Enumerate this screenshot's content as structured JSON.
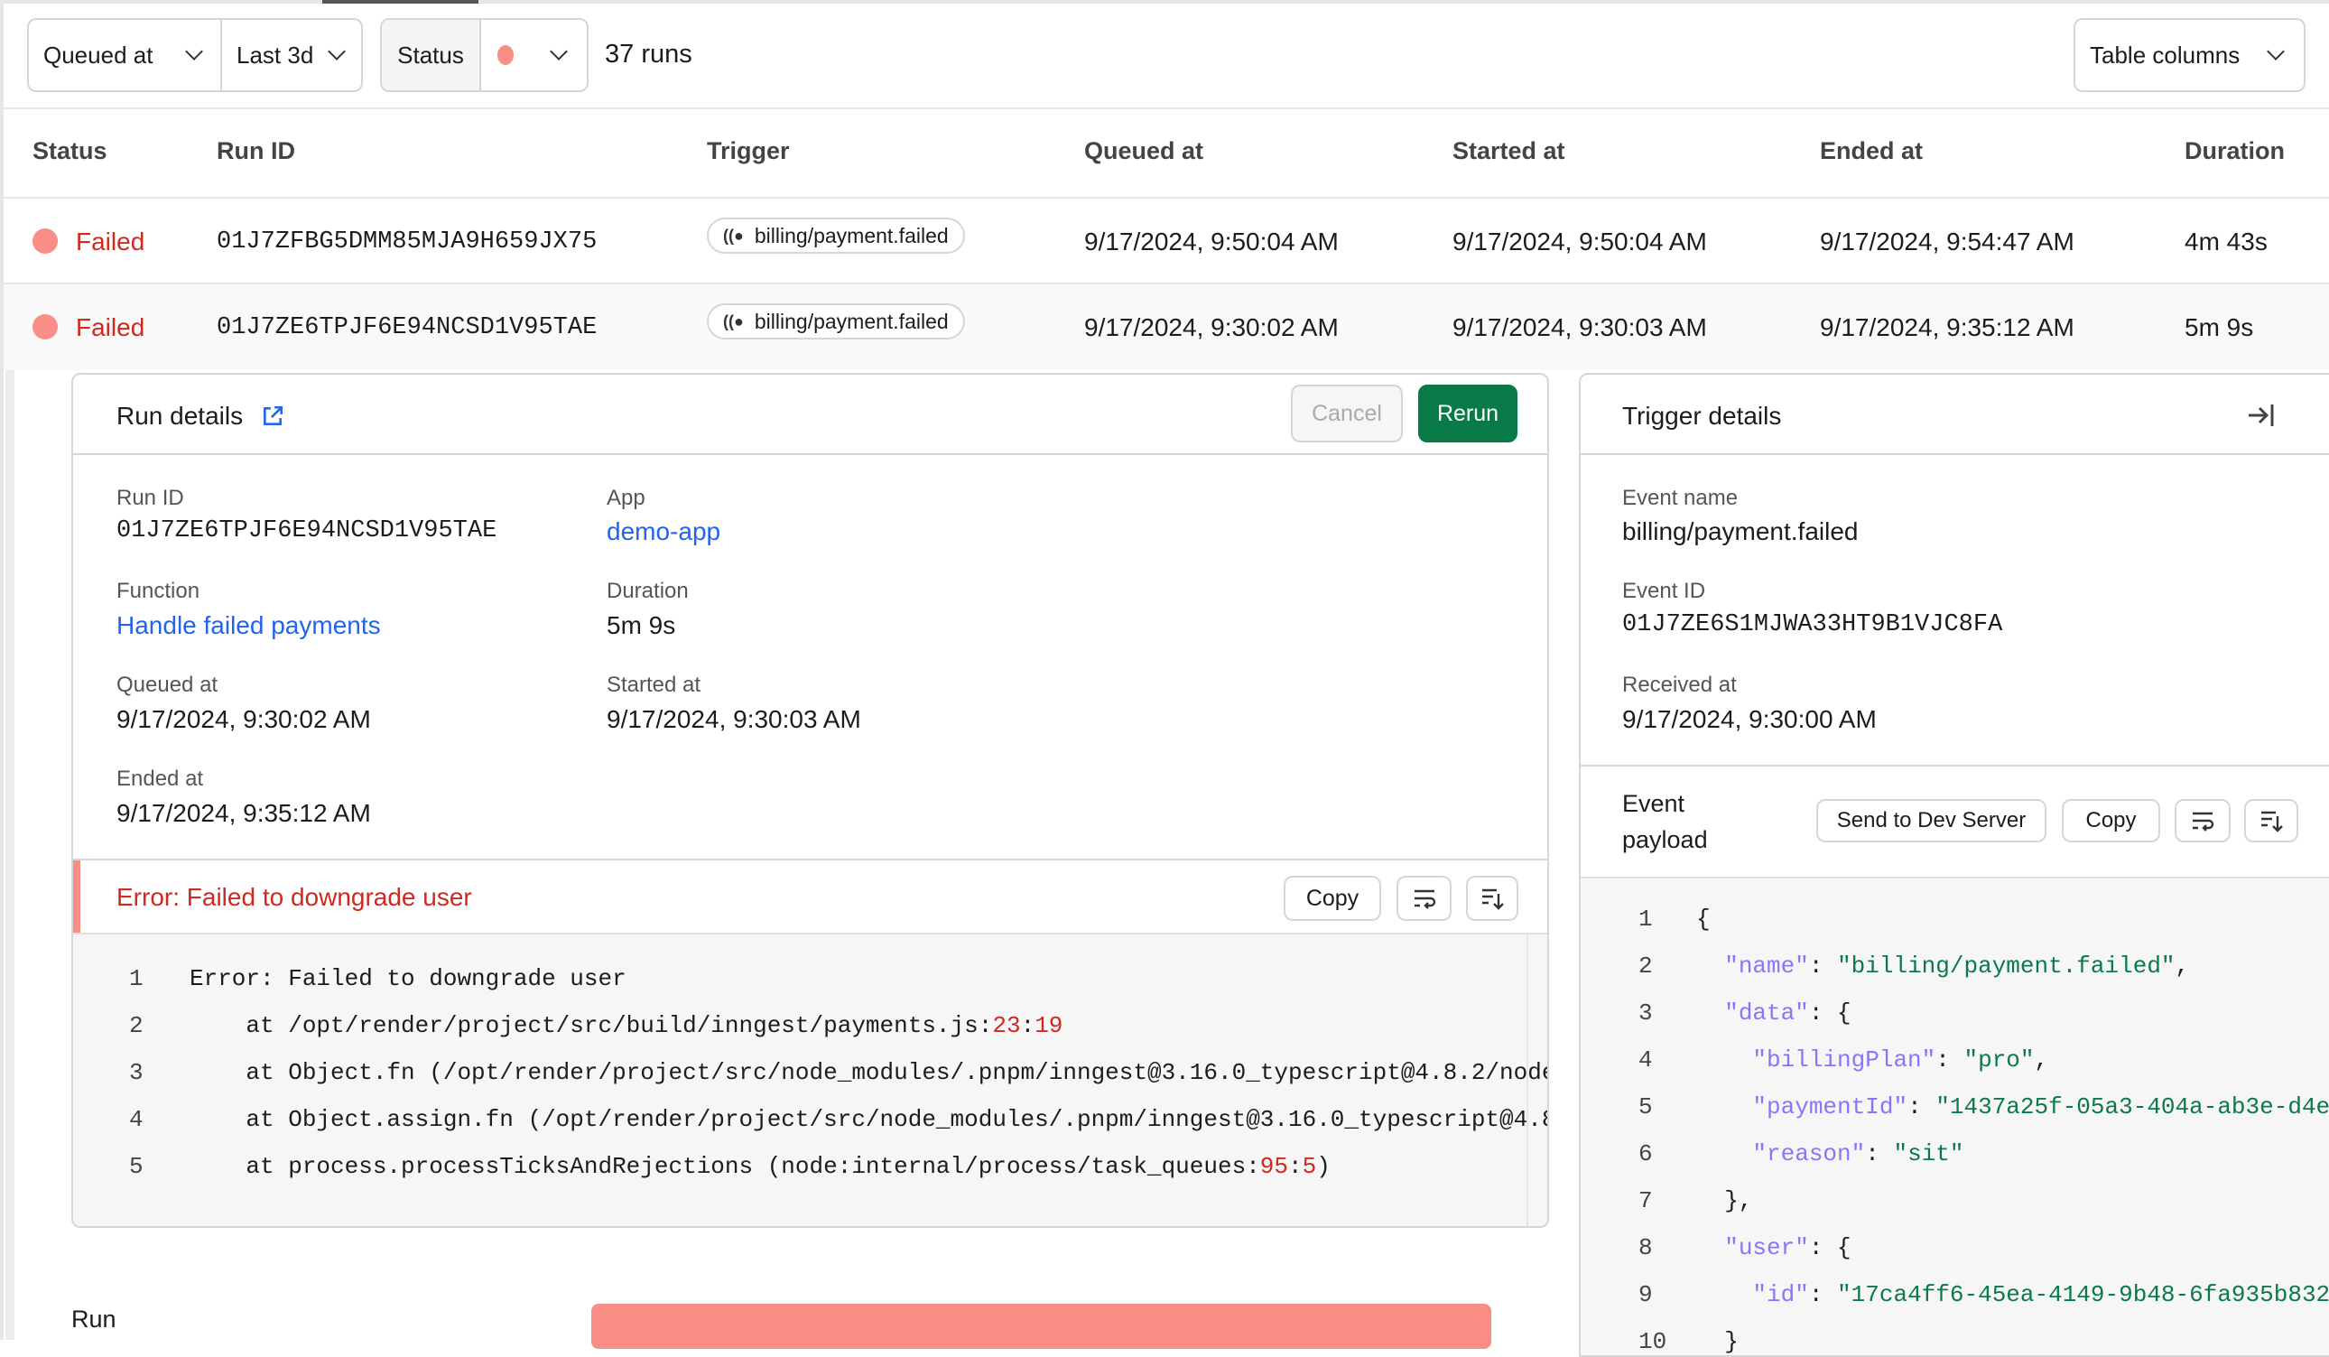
{
  "toolbar": {
    "time_field": "Queued at",
    "time_range": "Last 3d",
    "status_label": "Status",
    "status_color": "#f98e87",
    "run_count": "37 runs",
    "table_columns": "Table columns"
  },
  "table": {
    "headers": [
      "Status",
      "Run ID",
      "Trigger",
      "Queued at",
      "Started at",
      "Ended at",
      "Duration"
    ],
    "rows": [
      {
        "status": "Failed",
        "run_id": "01J7ZFBG5DMM85MJA9H659JX75",
        "trigger": "billing/payment.failed",
        "queued": "9/17/2024, 9:50:04 AM",
        "started": "9/17/2024, 9:50:04 AM",
        "ended": "9/17/2024, 9:54:47 AM",
        "duration": "4m 43s"
      },
      {
        "status": "Failed",
        "run_id": "01J7ZE6TPJF6E94NCSD1V95TAE",
        "trigger": "billing/payment.failed",
        "queued": "9/17/2024, 9:30:02 AM",
        "started": "9/17/2024, 9:30:03 AM",
        "ended": "9/17/2024, 9:35:12 AM",
        "duration": "5m 9s"
      }
    ]
  },
  "run_details": {
    "title": "Run details",
    "cancel": "Cancel",
    "rerun": "Rerun",
    "fields": {
      "run_id": {
        "label": "Run ID",
        "value": "01J7ZE6TPJF6E94NCSD1V95TAE"
      },
      "app": {
        "label": "App",
        "value": "demo-app"
      },
      "function": {
        "label": "Function",
        "value": "Handle failed payments"
      },
      "duration": {
        "label": "Duration",
        "value": "5m 9s"
      },
      "queued": {
        "label": "Queued at",
        "value": "9/17/2024, 9:30:02 AM"
      },
      "started": {
        "label": "Started at",
        "value": "9/17/2024, 9:30:03 AM"
      },
      "ended": {
        "label": "Ended at",
        "value": "9/17/2024, 9:35:12 AM"
      }
    },
    "error": {
      "title": "Error: Failed to downgrade user",
      "copy": "Copy",
      "lines": [
        [
          {
            "t": "Error: Failed to downgrade user"
          }
        ],
        [
          {
            "t": "    at /opt/render/project/src/build/inngest/payments.js:"
          },
          {
            "t": "23",
            "c": "num"
          },
          {
            "t": ":"
          },
          {
            "t": "19",
            "c": "num"
          }
        ],
        [
          {
            "t": "    at Object.fn (/opt/render/project/src/node_modules/.pnpm/inngest@3.16.0_typescript@4.8.2/node"
          }
        ],
        [
          {
            "t": "    at Object.assign.fn (/opt/render/project/src/node_modules/.pnpm/inngest@3.16.0_typescript@4.8"
          }
        ],
        [
          {
            "t": "    at process.processTicksAndRejections (node:internal/process/task_queues:"
          },
          {
            "t": "95",
            "c": "num"
          },
          {
            "t": ":"
          },
          {
            "t": "5",
            "c": "num"
          },
          {
            "t": ")"
          }
        ]
      ]
    },
    "timeline_label": "Run",
    "timeline_color": "#f98e87"
  },
  "trigger_details": {
    "title": "Trigger details",
    "fields": {
      "event_name": {
        "label": "Event name",
        "value": "billing/payment.failed"
      },
      "event_id": {
        "label": "Event ID",
        "value": "01J7ZE6S1MJWA33HT9B1VJC8FA"
      },
      "received": {
        "label": "Received at",
        "value": "9/17/2024, 9:30:00 AM"
      }
    },
    "payload_label": "Event payload",
    "send_dev": "Send to Dev Server",
    "copy": "Copy",
    "payload_lines": [
      [
        {
          "t": "{"
        }
      ],
      [
        {
          "t": "  "
        },
        {
          "t": "\"name\"",
          "c": "key"
        },
        {
          "t": ": "
        },
        {
          "t": "\"billing/payment.failed\"",
          "c": "str"
        },
        {
          "t": ","
        }
      ],
      [
        {
          "t": "  "
        },
        {
          "t": "\"data\"",
          "c": "key"
        },
        {
          "t": ": {"
        }
      ],
      [
        {
          "t": "    "
        },
        {
          "t": "\"billingPlan\"",
          "c": "key"
        },
        {
          "t": ": "
        },
        {
          "t": "\"pro\"",
          "c": "str"
        },
        {
          "t": ","
        }
      ],
      [
        {
          "t": "    "
        },
        {
          "t": "\"paymentId\"",
          "c": "key"
        },
        {
          "t": ": "
        },
        {
          "t": "\"1437a25f-05a3-404a-ab3e-d4e",
          "c": "str"
        }
      ],
      [
        {
          "t": "    "
        },
        {
          "t": "\"reason\"",
          "c": "key"
        },
        {
          "t": ": "
        },
        {
          "t": "\"sit\"",
          "c": "str"
        }
      ],
      [
        {
          "t": "  },"
        }
      ],
      [
        {
          "t": "  "
        },
        {
          "t": "\"user\"",
          "c": "key"
        },
        {
          "t": ": {"
        }
      ],
      [
        {
          "t": "    "
        },
        {
          "t": "\"id\"",
          "c": "key"
        },
        {
          "t": ": "
        },
        {
          "t": "\"17ca4ff6-45ea-4149-9b48-6fa935b832",
          "c": "str"
        }
      ],
      [
        {
          "t": "  }"
        }
      ]
    ]
  },
  "colors": {
    "accent_green": "#077a48",
    "failed_red": "#cf2a1f",
    "link_blue": "#2463eb"
  }
}
